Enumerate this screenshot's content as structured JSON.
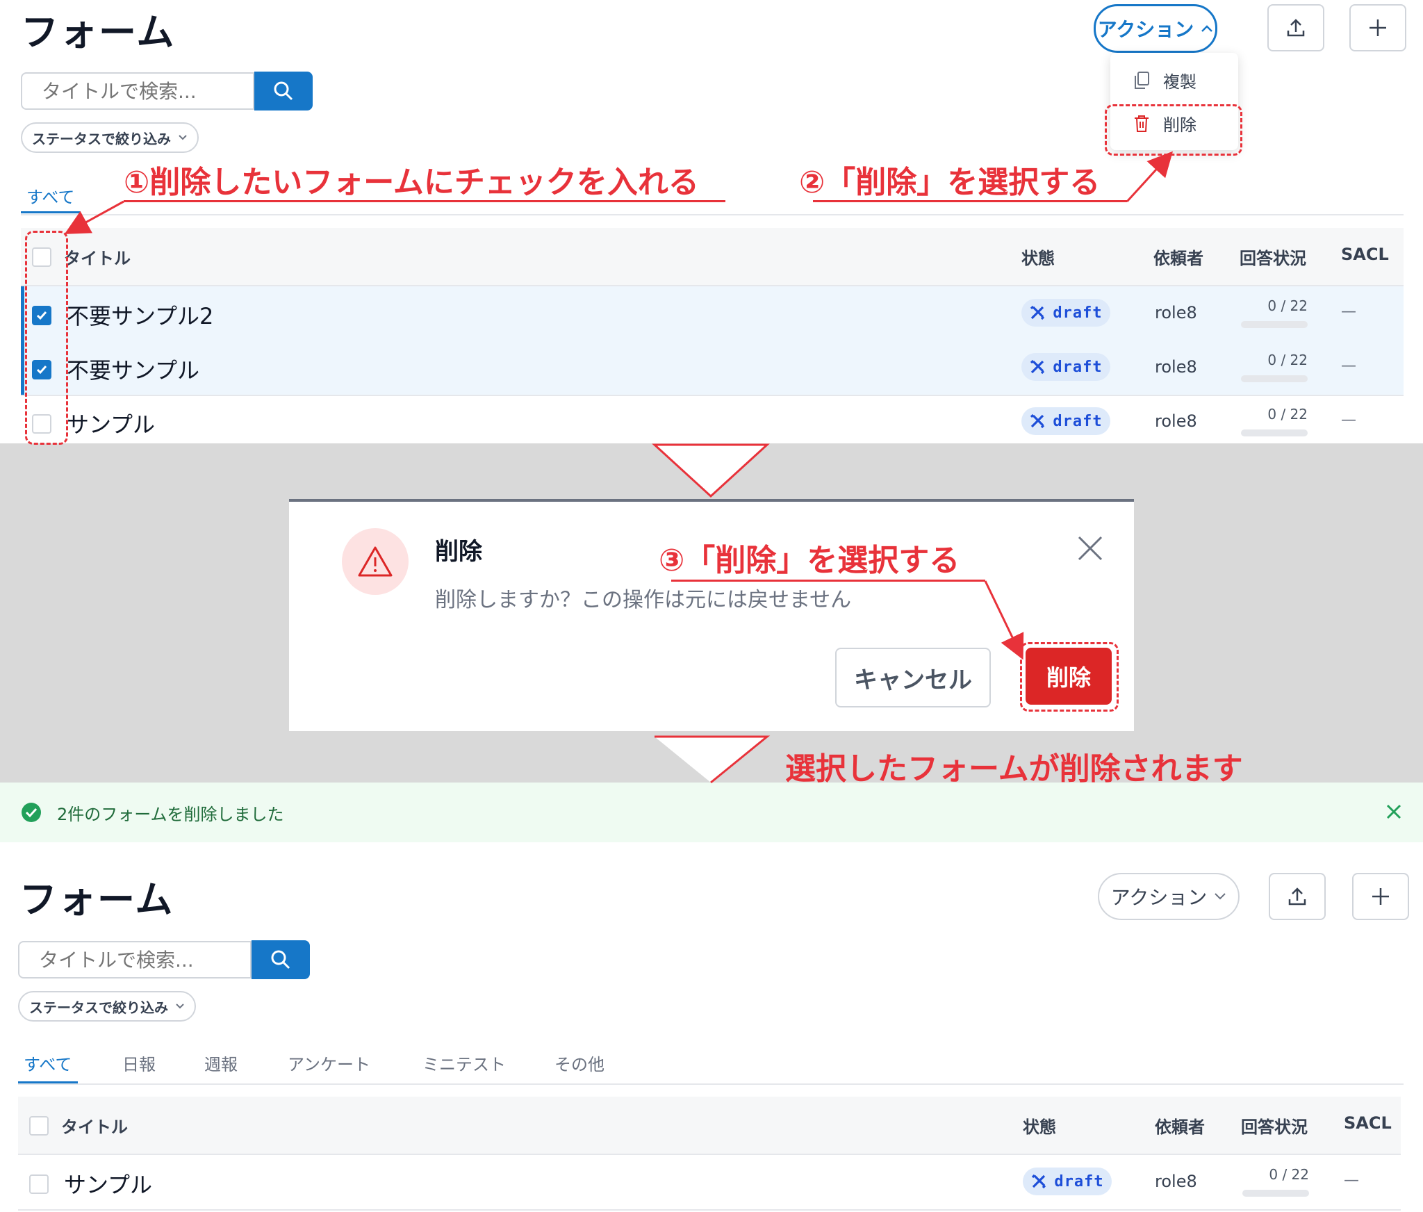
{
  "colors": {
    "accent": "#1677c8",
    "annotation": "#e8323a",
    "danger": "#dc2626",
    "success": "#22a05a"
  },
  "page": {
    "title": "フォーム",
    "action_label": "アクション",
    "search_placeholder": "タイトルで検索...",
    "status_filter": "ステータスで絞り込み"
  },
  "dropdown": {
    "duplicate": "複製",
    "delete": "削除"
  },
  "top_tabs": [
    {
      "label": "すべて",
      "active": true
    }
  ],
  "table": {
    "columns": [
      "タイトル",
      "状態",
      "依頼者",
      "回答状況",
      "SACL"
    ],
    "rows_before": [
      {
        "title": "不要サンプル2",
        "checked": true,
        "status": "draft",
        "requester": "role8",
        "progress": "0 / 22",
        "progress_fraction": 0,
        "sacl": "—"
      },
      {
        "title": "不要サンプル",
        "checked": true,
        "status": "draft",
        "requester": "role8",
        "progress": "0 / 22",
        "progress_fraction": 0,
        "sacl": "—"
      },
      {
        "title": "サンプル",
        "checked": false,
        "status": "draft",
        "requester": "role8",
        "progress": "0 / 22",
        "progress_fraction": 0,
        "sacl": "—"
      }
    ],
    "rows_after": [
      {
        "title": "サンプル",
        "checked": false,
        "status": "draft",
        "requester": "role8",
        "progress": "0 / 22",
        "progress_fraction": 0,
        "sacl": "—"
      }
    ]
  },
  "annotations": {
    "step1": "①削除したいフォームにチェックを入れる",
    "step2": "②「削除」を選択する",
    "step3": "③「削除」を選択する",
    "result": "選択したフォームが削除されます"
  },
  "modal": {
    "title": "削除",
    "message": "削除しますか？この操作は元には戻せません",
    "cancel": "キャンセル",
    "confirm": "削除"
  },
  "toast": {
    "message": "2件のフォームを削除しました"
  },
  "bottom_tabs": [
    {
      "label": "すべて",
      "active": true
    },
    {
      "label": "日報",
      "active": false
    },
    {
      "label": "週報",
      "active": false
    },
    {
      "label": "アンケート",
      "active": false
    },
    {
      "label": "ミニテスト",
      "active": false
    },
    {
      "label": "その他",
      "active": false
    }
  ]
}
